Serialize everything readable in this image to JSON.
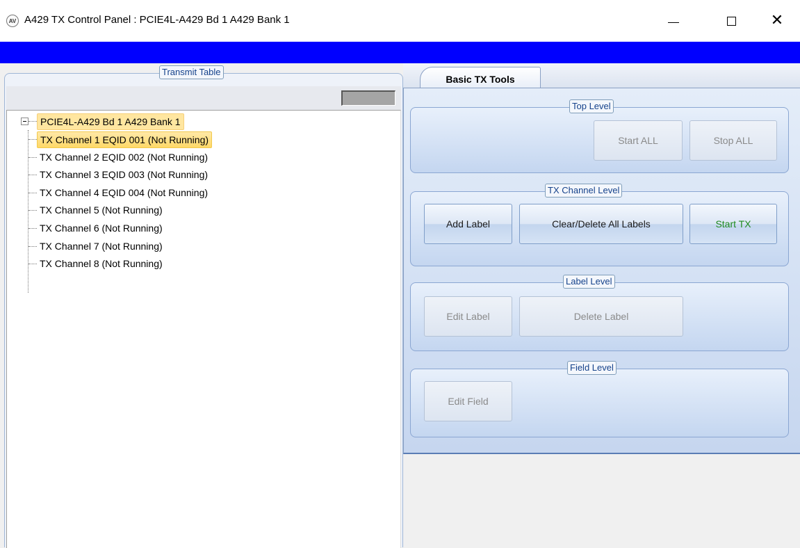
{
  "window": {
    "icon": "AV",
    "title": "A429 TX Control Panel : PCIE4L-A429 Bd 1 A429 Bank 1",
    "controls": {
      "minimize": "minimize-icon",
      "maximize": "maximize-icon",
      "close": "✕"
    }
  },
  "colors": {
    "band": "#0000ff",
    "selection": "#ffd866",
    "start_tx_text": "#1f8a1f"
  },
  "transmit_table": {
    "legend": "Transmit Table",
    "tree": {
      "root": "PCIE4L-A429 Bd 1 A429 Bank 1",
      "channels": [
        "TX Channel 1 EQID 001 (Not Running)",
        "TX Channel 2 EQID 002 (Not Running)",
        "TX Channel 3 EQID 003 (Not Running)",
        "TX Channel 4 EQID 004 (Not Running)",
        "TX Channel 5 (Not Running)",
        "TX Channel 6 (Not Running)",
        "TX Channel 7 (Not Running)",
        "TX Channel 8 (Not Running)"
      ],
      "selected_index": 0
    }
  },
  "tabs": [
    {
      "label": "Basic TX Tools",
      "active": true
    }
  ],
  "groups": {
    "top_level": {
      "legend": "Top Level",
      "start_all": "Start ALL",
      "stop_all": "Stop ALL"
    },
    "tx_channel_level": {
      "legend": "TX Channel Level",
      "add_label": "Add Label",
      "clear_delete": "Clear/Delete All Labels",
      "start_tx": "Start TX"
    },
    "label_level": {
      "legend": "Label Level",
      "edit_label": "Edit Label",
      "delete_label": "Delete Label"
    },
    "field_level": {
      "legend": "Field Level",
      "edit_field": "Edit Field"
    }
  }
}
